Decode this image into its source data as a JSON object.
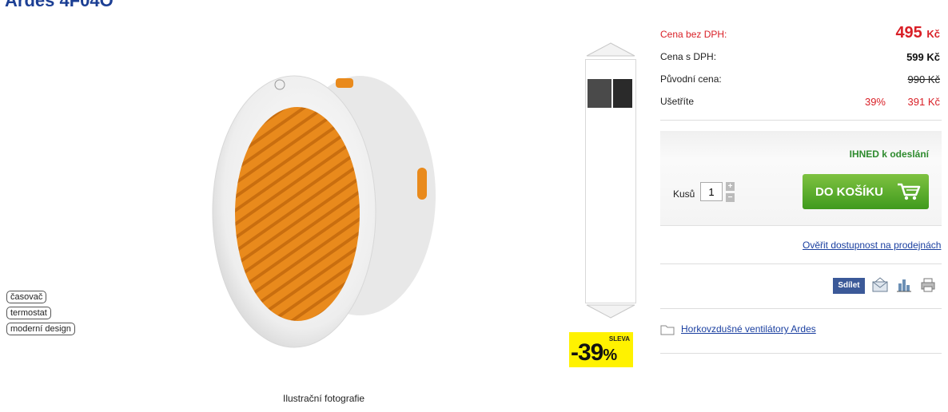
{
  "product": {
    "title": "Ardes 4F04O"
  },
  "tags": [
    "časovač",
    "termostat",
    "moderní design"
  ],
  "photo": {
    "caption": "Ilustrační fotografie"
  },
  "discount_badge": {
    "label": "SLEVA",
    "value": "-39",
    "unit": "%"
  },
  "prices": {
    "without_vat": {
      "label": "Cena bez DPH:",
      "value": "495",
      "currency": "Kč"
    },
    "with_vat": {
      "label": "Cena s DPH:",
      "value": "599 Kč"
    },
    "original": {
      "label": "Původní cena:",
      "value": "990 Kč"
    },
    "savings": {
      "label": "Ušetříte",
      "percent": "39%",
      "amount": "391 Kč"
    }
  },
  "buy": {
    "availability": "IHNED k odeslání",
    "qty_label": "Kusů",
    "qty_value": "1",
    "cart_label": "DO KOŠÍKU"
  },
  "links": {
    "check_availability": "Ověřit dostupnost na prodejnách"
  },
  "share": {
    "share_label": "Sdílet",
    "icons": [
      "email-icon",
      "compare-icon",
      "print-icon"
    ]
  },
  "category": {
    "label": "Horkovzdušné ventilátory Ardes"
  },
  "colors": {
    "accent_red": "#d91f26",
    "link_blue": "#1a3fa0",
    "title_blue": "#1c3f94",
    "cart_green": "#5aae2e",
    "badge_yellow": "#fff200"
  }
}
